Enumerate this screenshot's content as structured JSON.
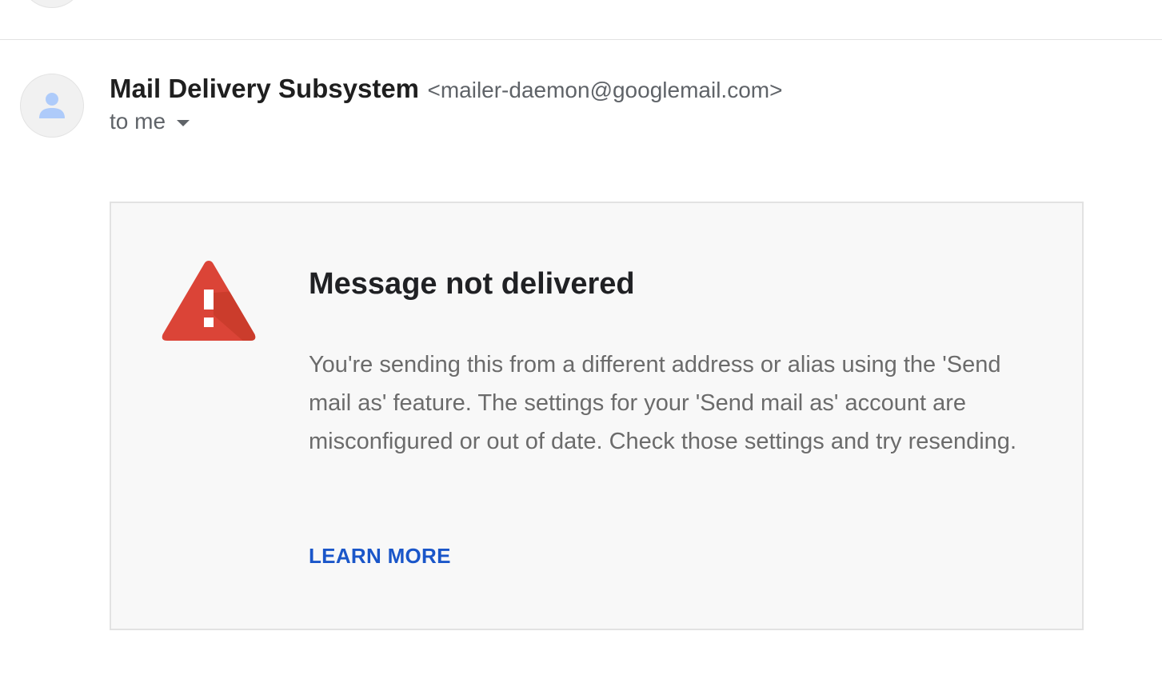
{
  "message": {
    "sender_name": "Mail Delivery Subsystem",
    "sender_email": "<mailer-daemon@googlemail.com>",
    "recipient_label": "to me"
  },
  "notice": {
    "title": "Message not delivered",
    "body": "You're sending this from a different address or alias using the 'Send mail as' feature. The settings for your 'Send mail as' account are misconfigured or out of date. Check those settings and try resending.",
    "action_label": "LEARN MORE"
  },
  "icons": {
    "avatar": "person-icon",
    "recipient_toggle": "caret-down-icon",
    "notice": "warning-icon"
  },
  "colors": {
    "warning_red": "#db4437",
    "link_blue": "#1a56c9",
    "avatar_person": "#aecbfa",
    "notice_background": "#f8f8f8"
  }
}
